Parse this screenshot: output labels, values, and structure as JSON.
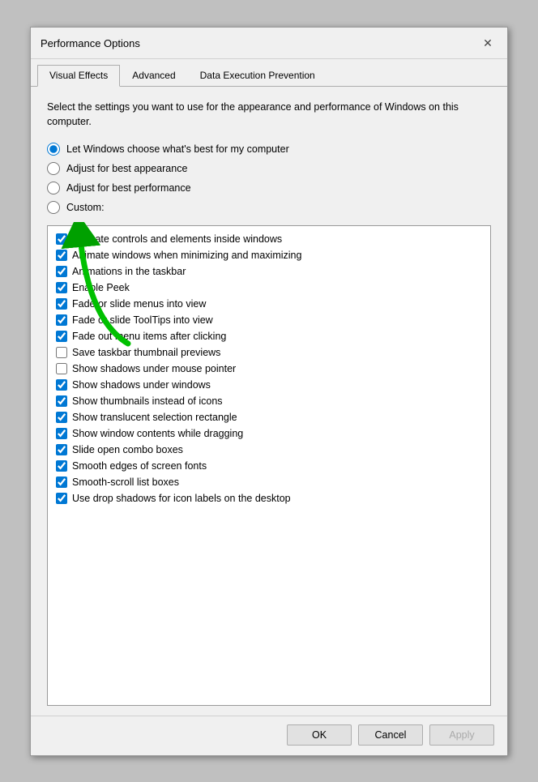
{
  "dialog": {
    "title": "Performance Options",
    "close_label": "✕"
  },
  "tabs": [
    {
      "id": "visual-effects",
      "label": "Visual Effects",
      "active": true
    },
    {
      "id": "advanced",
      "label": "Advanced",
      "active": false
    },
    {
      "id": "dep",
      "label": "Data Execution Prevention",
      "active": false
    }
  ],
  "description": "Select the settings you want to use for the appearance and performance of Windows on this computer.",
  "radio_options": [
    {
      "id": "r1",
      "label": "Let Windows choose what's best for my computer",
      "checked": true
    },
    {
      "id": "r2",
      "label": "Adjust for best appearance",
      "checked": false
    },
    {
      "id": "r3",
      "label": "Adjust for best performance",
      "checked": false
    },
    {
      "id": "r4",
      "label": "Custom:",
      "checked": false
    }
  ],
  "checkboxes": [
    {
      "id": "cb1",
      "label": "Animate controls and elements inside windows",
      "checked": true
    },
    {
      "id": "cb2",
      "label": "Animate windows when minimizing and maximizing",
      "checked": true
    },
    {
      "id": "cb3",
      "label": "Animations in the taskbar",
      "checked": true
    },
    {
      "id": "cb4",
      "label": "Enable Peek",
      "checked": true
    },
    {
      "id": "cb5",
      "label": "Fade or slide menus into view",
      "checked": true
    },
    {
      "id": "cb6",
      "label": "Fade or slide ToolTips into view",
      "checked": true
    },
    {
      "id": "cb7",
      "label": "Fade out menu items after clicking",
      "checked": true
    },
    {
      "id": "cb8",
      "label": "Save taskbar thumbnail previews",
      "checked": false
    },
    {
      "id": "cb9",
      "label": "Show shadows under mouse pointer",
      "checked": false
    },
    {
      "id": "cb10",
      "label": "Show shadows under windows",
      "checked": true
    },
    {
      "id": "cb11",
      "label": "Show thumbnails instead of icons",
      "checked": true
    },
    {
      "id": "cb12",
      "label": "Show translucent selection rectangle",
      "checked": true
    },
    {
      "id": "cb13",
      "label": "Show window contents while dragging",
      "checked": true
    },
    {
      "id": "cb14",
      "label": "Slide open combo boxes",
      "checked": true
    },
    {
      "id": "cb15",
      "label": "Smooth edges of screen fonts",
      "checked": true
    },
    {
      "id": "cb16",
      "label": "Smooth-scroll list boxes",
      "checked": true
    },
    {
      "id": "cb17",
      "label": "Use drop shadows for icon labels on the desktop",
      "checked": true
    }
  ],
  "buttons": {
    "ok": "OK",
    "cancel": "Cancel",
    "apply": "Apply"
  }
}
